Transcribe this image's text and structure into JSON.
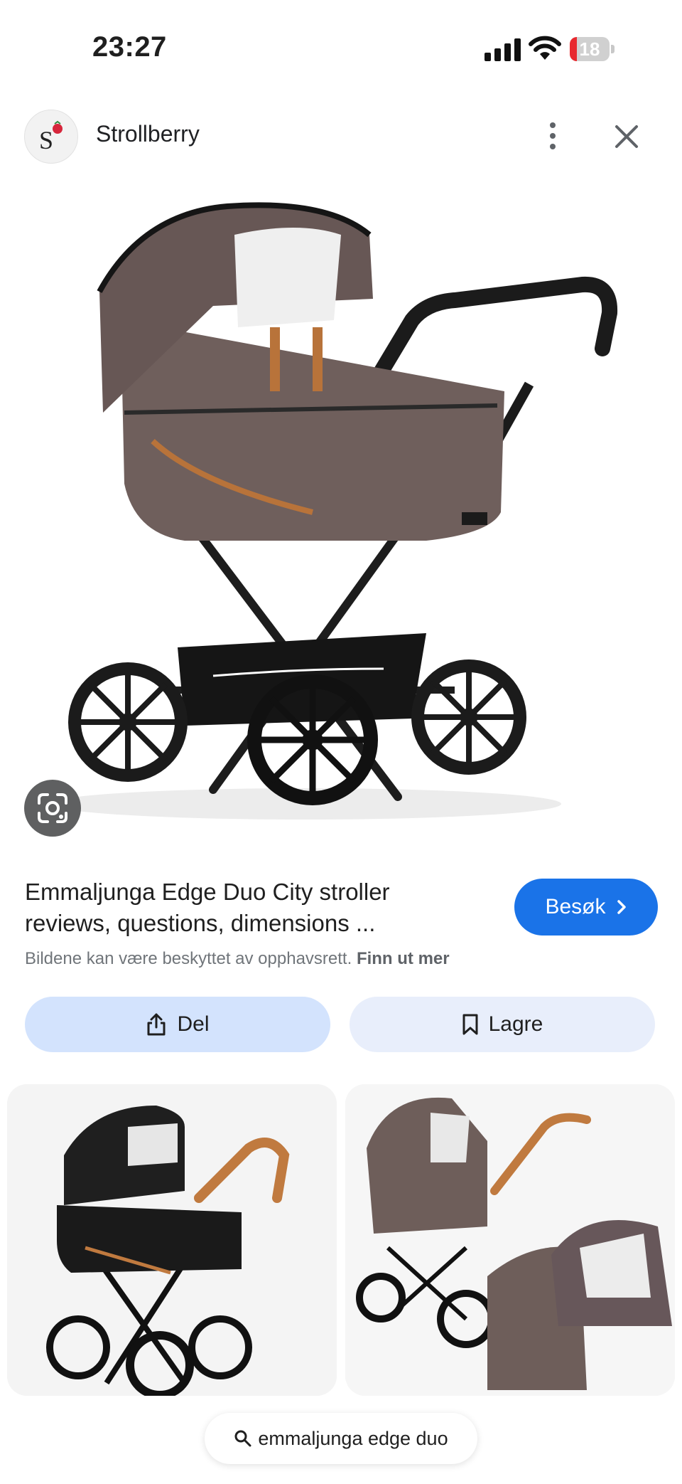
{
  "status_bar": {
    "time": "23:27",
    "battery_level": "18",
    "battery_color": "#e8292f"
  },
  "source": {
    "name": "Strollberry",
    "logo_letter": "S",
    "logo_icon": "strawberry-icon"
  },
  "result": {
    "title": "Emmaljunga Edge Duo City stroller reviews, questions, dimensions ...",
    "visit_label": "Besøk",
    "copyright_text": "Bildene kan være beskyttet av opphavsrett.",
    "copyright_link": "Finn ut mer",
    "share_label": "Del",
    "save_label": "Lagre",
    "accent_color": "#1a73e8"
  },
  "search": {
    "query": "emmaljunga edge duo"
  },
  "icons": [
    "more-vert-icon",
    "close-icon",
    "google-lens-icon",
    "chevron-right-icon",
    "share-icon",
    "bookmark-icon",
    "search-icon"
  ]
}
